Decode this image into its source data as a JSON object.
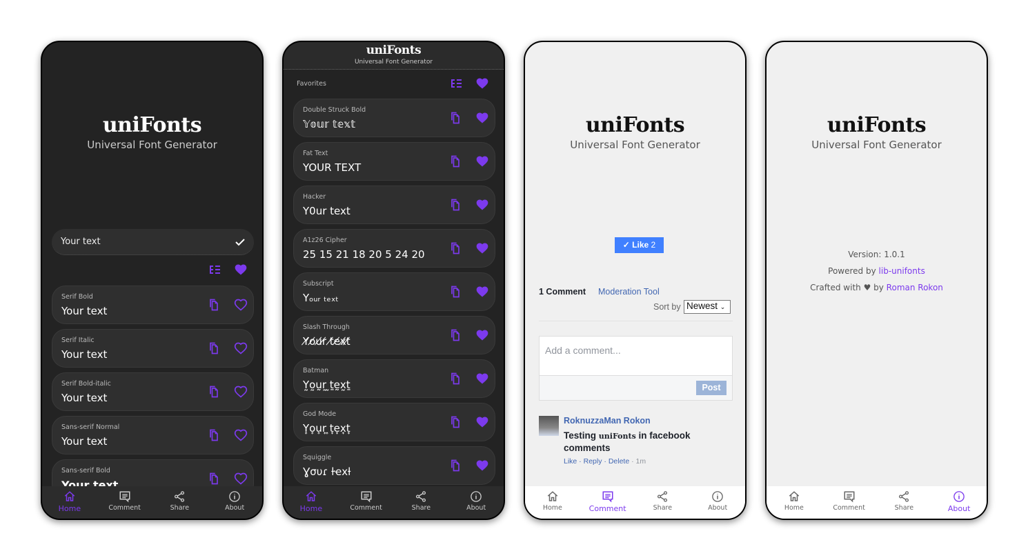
{
  "app": {
    "logo": "uniFonts",
    "subtitle": "Universal Font Generator"
  },
  "colors": {
    "accent": "#7c3aed",
    "dark_bg": "#232323",
    "card_bg": "#2f2f2f",
    "light_bg": "#f0f0f0",
    "fb_blue": "#4080ff",
    "fb_link": "#4267b2"
  },
  "nav": [
    {
      "label": "Home",
      "icon": "home-icon"
    },
    {
      "label": "Comment",
      "icon": "comment-icon"
    },
    {
      "label": "Share",
      "icon": "share-icon"
    },
    {
      "label": "About",
      "icon": "info-icon"
    }
  ],
  "home": {
    "input_value": "Your text",
    "cards": [
      {
        "label": "Serif Bold",
        "value": "Your text",
        "fav": false
      },
      {
        "label": "Serif Italic",
        "value": "Your text",
        "fav": false
      },
      {
        "label": "Serif Bold-italic",
        "value": "Your text",
        "fav": false
      },
      {
        "label": "Sans-serif Normal",
        "value": "Your text",
        "fav": false
      },
      {
        "label": "Sans-serif Bold",
        "value": "Your text",
        "fav": false
      }
    ]
  },
  "favorites": {
    "title": "Favorites",
    "cards": [
      {
        "label": "Double Struck Bold",
        "value": "𝕐𝕠𝕦𝕣 𝕥𝕖𝕩𝕥",
        "fav": true
      },
      {
        "label": "Fat Text",
        "value": "YOUR TEXT",
        "fav": true
      },
      {
        "label": "Hacker",
        "value": "Y0ur text",
        "fav": true
      },
      {
        "label": "A1z26 Cipher",
        "value": "25 15 21 18 20 5 24 20",
        "fav": true
      },
      {
        "label": "Subscript",
        "value": "Yₒᵤᵣ ₜₑₓₜ",
        "fav": true
      },
      {
        "label": "Slash Through",
        "value": "Y̸o̸u̸r̸ t̸e̸x̸t̸",
        "fav": true
      },
      {
        "label": "Batman",
        "value": "Y̰o̰ṵr̰ ̰ṯḛx̰ṯ",
        "fav": true
      },
      {
        "label": "God Mode",
        "value": "Y͎o͎u͎r͎ ͎t͎e͎x͎t͎",
        "fav": true
      },
      {
        "label": "Squiggle",
        "value": "Ɣσυɾ ƚҽxƚ",
        "fav": true
      }
    ]
  },
  "comments": {
    "like_label": "Like",
    "like_count": "2",
    "count_label": "1 Comment",
    "moderation": "Moderation Tool",
    "sort_label": "Sort by",
    "sort_value": "Newest",
    "placeholder": "Add a comment...",
    "post": "Post",
    "comment": {
      "author": "RoknuzzaMan Rokon",
      "text_pre": "Testing ",
      "text_logo": "uniFonts",
      "text_post": " in facebook comments",
      "like": "Like",
      "reply": "Reply",
      "delete": "Delete",
      "time": "1m"
    }
  },
  "about": {
    "version": "Version: 1.0.1",
    "powered_pre": "Powered by",
    "powered_link": " lib-unifonts",
    "crafted_pre": "Crafted with ♥ by ",
    "crafted_link": "Roman Rokon"
  }
}
